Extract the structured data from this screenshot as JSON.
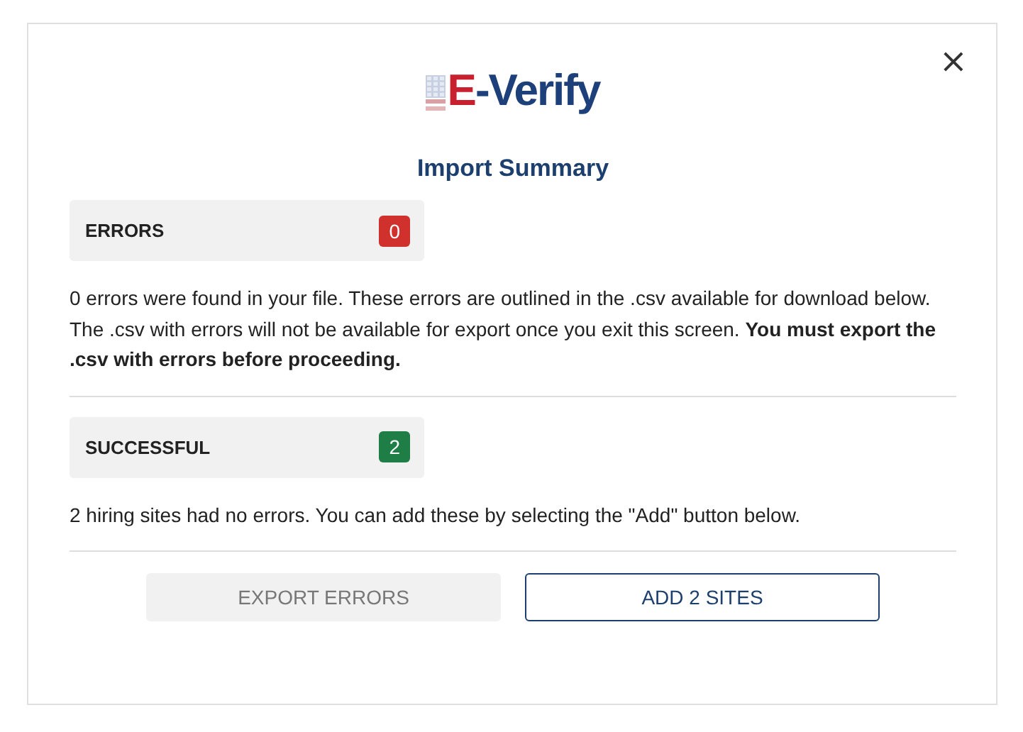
{
  "logo": {
    "text": "E-Verify"
  },
  "close": {
    "label": "×"
  },
  "title": "Import Summary",
  "sections": [
    {
      "kind": "errors",
      "label": "ERRORS",
      "count": "0",
      "color": "#d0312d",
      "message": "0 errors were found in your file. These errors are outlined in the .csv available for download below. The .csv with errors will not be available for export once you exit this screen.  **You must export the .csv with errors before proceeding.**"
    },
    {
      "kind": "success",
      "label": "SUCCESSFUL",
      "count": "2",
      "color": "#1e7e45",
      "message": "2 hiring sites had no errors. You can add these by selecting the \"Add\" button below."
    }
  ],
  "buttons": [
    {
      "label": "EXPORT ERRORS",
      "kind": "secondary",
      "disabled": true
    },
    {
      "label": "ADD 2 SITES",
      "kind": "primary",
      "disabled": false
    }
  ]
}
